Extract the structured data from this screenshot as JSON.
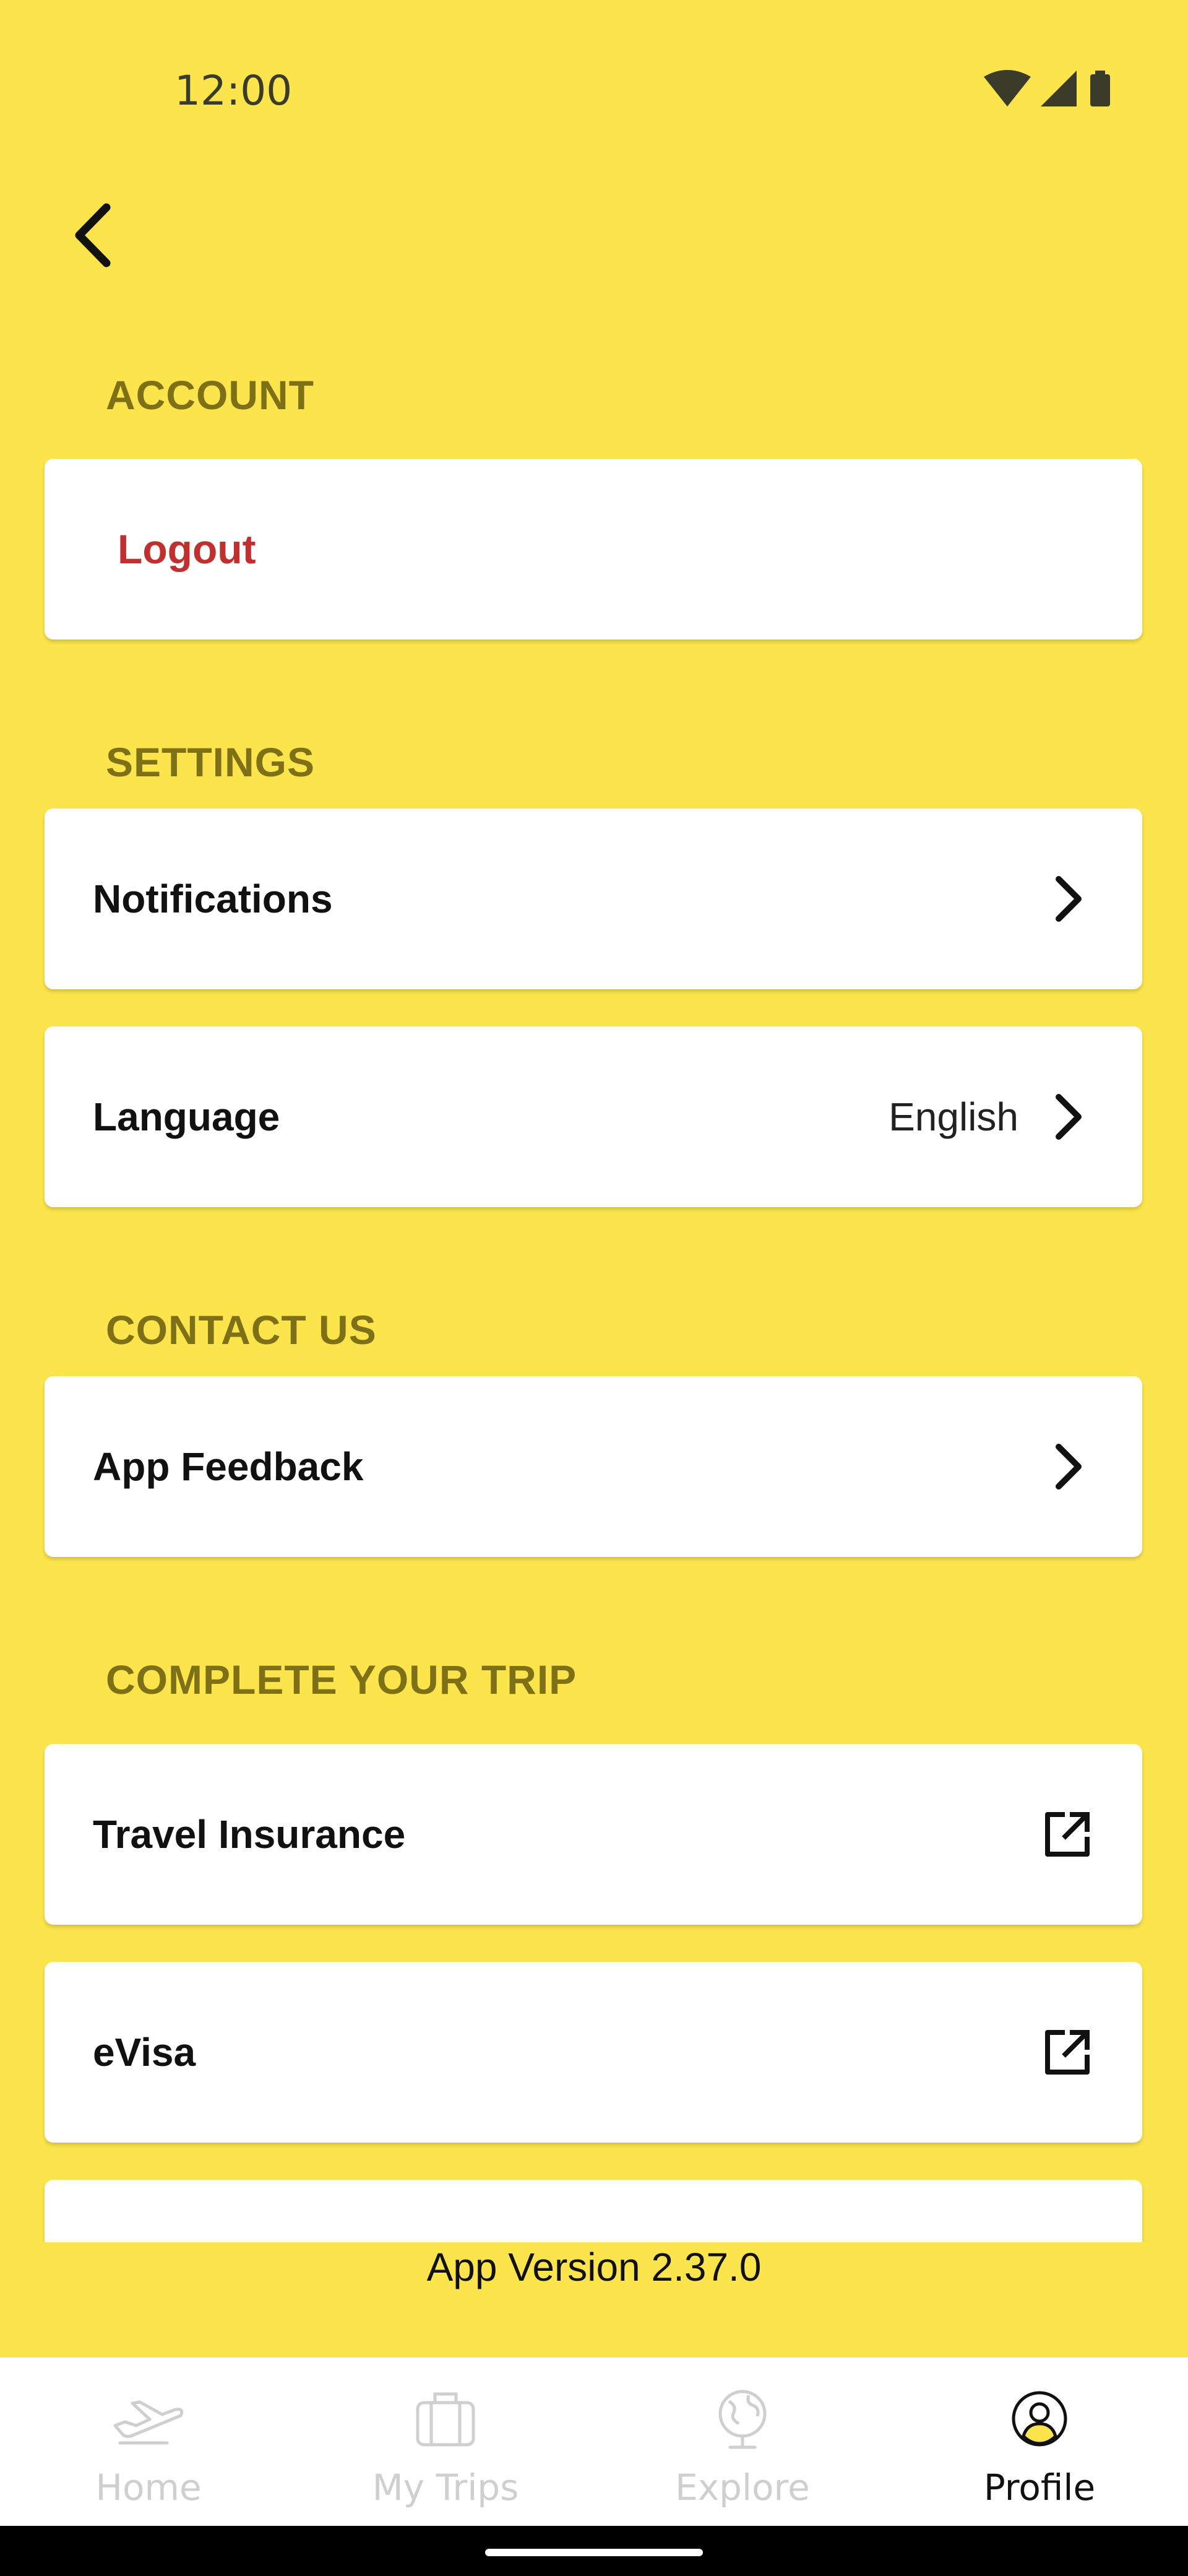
{
  "status_bar": {
    "time": "12:00",
    "icons": [
      "wifi-icon",
      "signal-icon",
      "battery-icon"
    ]
  },
  "header": {
    "back_icon": "chevron-left-icon"
  },
  "sections": {
    "account": {
      "title": "ACCOUNT",
      "logout_label": "Logout"
    },
    "settings": {
      "title": "SETTINGS",
      "notifications_label": "Notifications",
      "language_label": "Language",
      "language_value": "English"
    },
    "contact": {
      "title": "CONTACT US",
      "feedback_label": "App Feedback"
    },
    "trip": {
      "title": "COMPLETE YOUR TRIP",
      "insurance_label": "Travel Insurance",
      "evisa_label": "eVisa"
    }
  },
  "app_version": "App Version 2.37.0",
  "bottom_nav": {
    "items": [
      {
        "label": "Home",
        "icon": "airplane-icon",
        "active": false
      },
      {
        "label": "My Trips",
        "icon": "suitcase-icon",
        "active": false
      },
      {
        "label": "Explore",
        "icon": "globe-icon",
        "active": false
      },
      {
        "label": "Profile",
        "icon": "profile-icon",
        "active": true
      }
    ]
  },
  "colors": {
    "background": "#FCE44D",
    "section_header": "#7d7016",
    "logout": "#c0302f",
    "card": "#ffffff",
    "nav_inactive": "#cfcfcf",
    "nav_active": "#111111"
  }
}
